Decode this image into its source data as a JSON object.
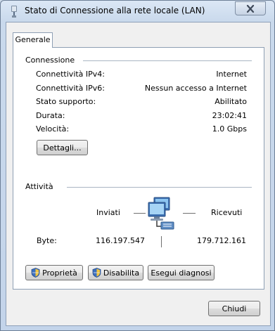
{
  "window": {
    "title": "Stato di Connessione alla rete locale (LAN)",
    "close_icon": "close-x-icon"
  },
  "tab": {
    "label": "Generale"
  },
  "connection": {
    "title": "Connessione",
    "rows": [
      {
        "label": "Connettività IPv4:",
        "value": "Internet"
      },
      {
        "label": "Connettività IPv6:",
        "value": "Nessun accesso a Internet"
      },
      {
        "label": "Stato supporto:",
        "value": "Abilitato"
      },
      {
        "label": "Durata:",
        "value": "23:02:41"
      },
      {
        "label": "Velocità:",
        "value": "1.0 Gbps"
      }
    ],
    "details_button": "Dettagli..."
  },
  "activity": {
    "title": "Attività",
    "sent_label": "Inviati",
    "received_label": "Ricevuti",
    "bytes_label": "Byte:",
    "bytes_sent": "116.197.547",
    "bytes_received": "179.712.161",
    "icon": "network-computers-icon"
  },
  "buttons": {
    "properties": "Proprietà",
    "disable": "Disabilita",
    "diagnose": "Esegui diagnosi",
    "close": "Chiudi"
  },
  "colors": {
    "title_bar": "#c9d9ec",
    "panel": "#ffffff",
    "dialog": "#f0f0f0",
    "group_line": "#a9b5c3"
  }
}
